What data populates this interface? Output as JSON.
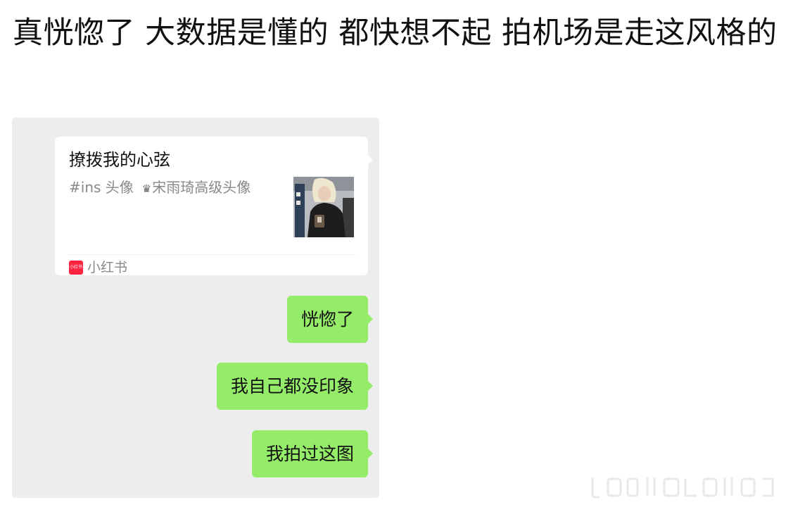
{
  "post": {
    "title": "真恍惚了 大数据是懂的 都快想不起 拍机场是走这风格的"
  },
  "share_card": {
    "title": "撩拨我的心弦",
    "tag1": "#ins 头像",
    "tag2": "宋雨琦高级头像",
    "source_logo_text": "小红书",
    "source_name": "小红书",
    "thumbnail_icon": "photo-thumbnail"
  },
  "messages": [
    {
      "text": "恍惚了"
    },
    {
      "text": "我自己都没印象"
    },
    {
      "text": "我拍过这图"
    }
  ],
  "colors": {
    "chat_background": "#ededed",
    "bubble_green": "#95ec69",
    "card_background": "#ffffff",
    "brand_red": "#ff2442"
  }
}
